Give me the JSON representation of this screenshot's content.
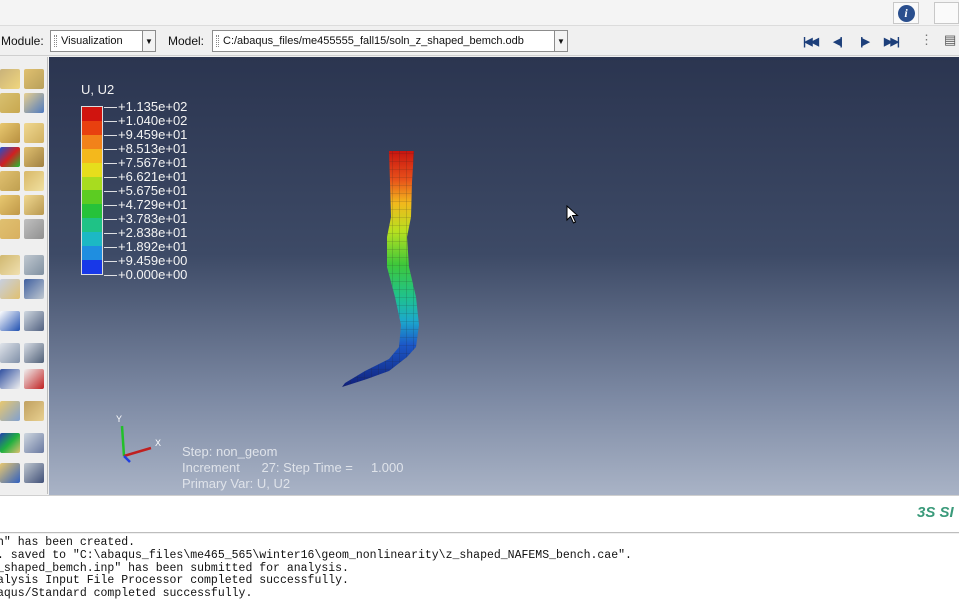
{
  "toolbar_top": {
    "info_icon": "info-icon"
  },
  "context_bar": {
    "module_label": "Module:",
    "module_value": "Visualization",
    "model_label": "Model:",
    "model_value": "C:/abaqus_files/me455555_fall15/soln_z_shaped_bemch.odb",
    "playback": [
      {
        "icon": "first-frame-icon",
        "glyph": "⏮"
      },
      {
        "icon": "previous-frame-icon",
        "glyph": "◀"
      },
      {
        "icon": "next-frame-icon",
        "glyph": "▶"
      },
      {
        "icon": "last-frame-icon",
        "glyph": "⏭"
      }
    ]
  },
  "legend": {
    "title": "U, U2",
    "values": [
      "+1.135e+02",
      "+1.040e+02",
      "+9.459e+01",
      "+8.513e+01",
      "+7.567e+01",
      "+6.621e+01",
      "+5.675e+01",
      "+4.729e+01",
      "+3.783e+01",
      "+2.838e+01",
      "+1.892e+01",
      "+9.459e+00",
      "+0.000e+00"
    ],
    "colors": [
      "#d0140f",
      "#e8400f",
      "#f2821a",
      "#f4b81c",
      "#e6de1c",
      "#a8dc1f",
      "#5ccc22",
      "#26c23a",
      "#1fc286",
      "#1cb8c4",
      "#1f8ee0",
      "#1838e8"
    ]
  },
  "triad": {
    "y_label": "Y",
    "x_label": "X"
  },
  "step_info": {
    "step": "Step: non_geom",
    "increment": "Increment      27: Step Time =     1.000",
    "primary_var": "Primary Var: U, U2"
  },
  "brand": {
    "logo_text": "3S SI"
  },
  "console": {
    "messages": [
      "h\" has been created.",
      ". saved to \"C:\\abaqus_files\\me465_565\\winter16\\geom_nonlinearity\\z_shaped_NAFEMS_bench.cae\".",
      "_shaped_bemch.inp\" has been submitted for analysis.",
      "alysis Input File Processor completed successfully.",
      "aqus/Standard completed successfully."
    ]
  }
}
